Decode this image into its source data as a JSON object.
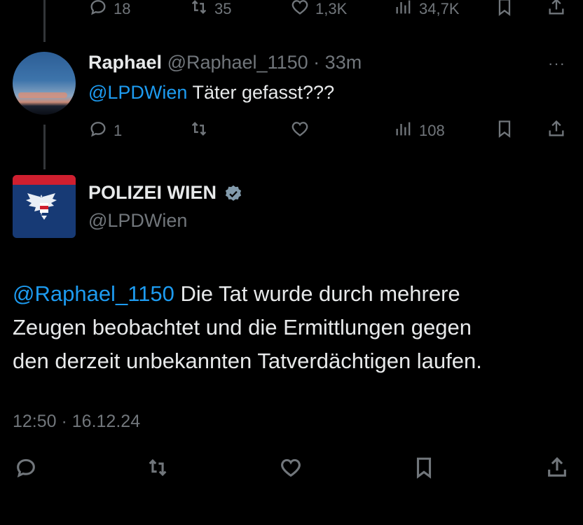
{
  "top_tweet": {
    "actions": {
      "replies": "18",
      "reposts": "35",
      "likes": "1,3K",
      "views": "34,7K"
    }
  },
  "reply": {
    "name": "Raphael",
    "handle": "@Raphael_1150",
    "separator": "·",
    "time": "33m",
    "more": "···",
    "mention": "@LPDWien",
    "text": " Täter gefasst???",
    "actions": {
      "replies": "1",
      "views": "108"
    }
  },
  "main_tweet": {
    "name": "POLIZEI WIEN",
    "handle": "@LPDWien",
    "mention": "@Raphael_1150",
    "text_line1": " Die Tat wurde durch mehrere",
    "text_line2": "Zeugen beobachtet und die Ermittlungen gegen",
    "text_line3": "den derzeit unbekannten Tatverdächtigen laufen.",
    "timestamp": "12:50 · 16.12.24"
  },
  "colors": {
    "accent": "#1d9bf0",
    "muted": "#71767b",
    "verified": "#829aab",
    "police_red": "#d01f2f",
    "police_blue": "#173a75"
  }
}
